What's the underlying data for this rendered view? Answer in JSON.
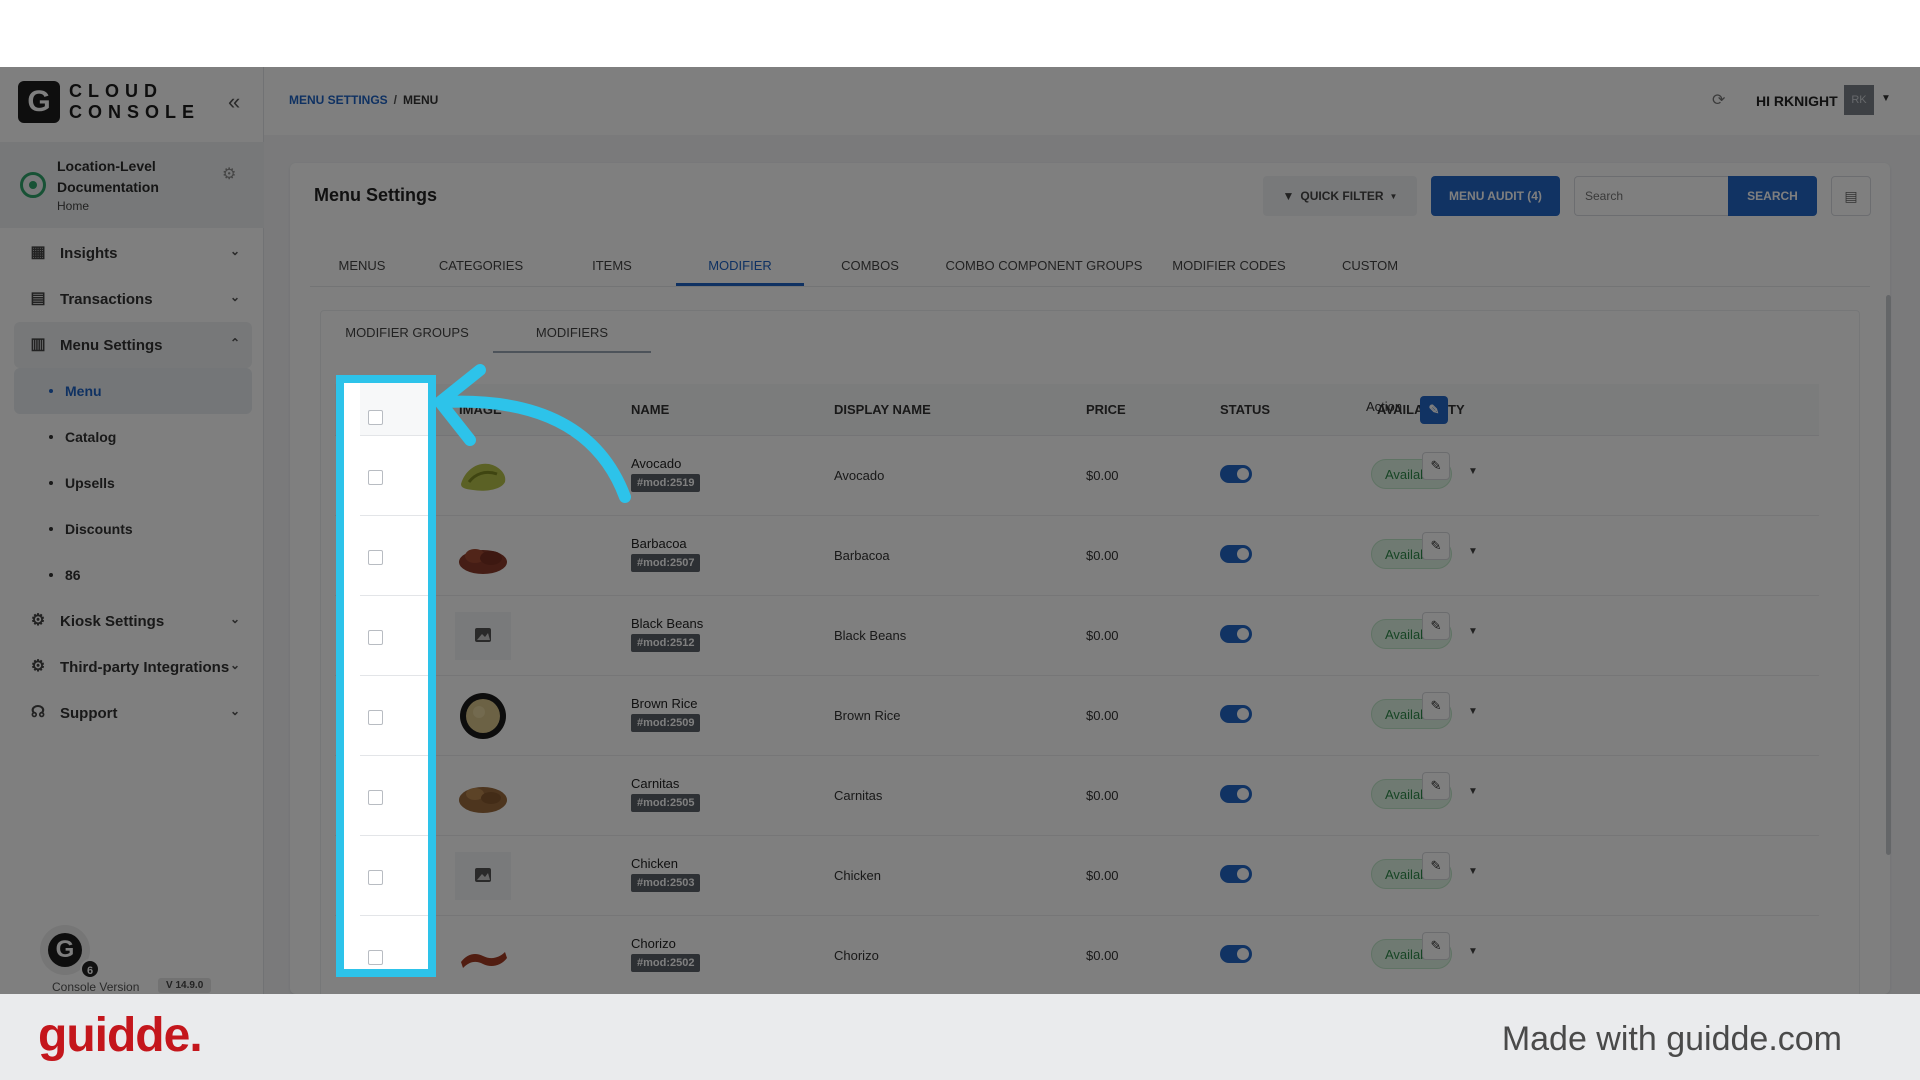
{
  "sidebar": {
    "logo_mark": "G",
    "logo_line1": "CLOUD",
    "logo_line2": "CONSOLE",
    "location_title": "Location-Level Documentation",
    "location_sub": "Home",
    "nav": [
      {
        "label": "Insights",
        "icon": "insights-icon"
      },
      {
        "label": "Transactions",
        "icon": "transactions-icon"
      },
      {
        "label": "Menu Settings",
        "icon": "menu-settings-icon"
      }
    ],
    "sub_items": [
      "Menu",
      "Catalog",
      "Upsells",
      "Discounts",
      "86"
    ],
    "nav_bottom": [
      {
        "label": "Kiosk Settings",
        "icon": "gear-icon"
      },
      {
        "label": "Third-party Integrations",
        "icon": "gear-icon"
      },
      {
        "label": "Support",
        "icon": "headset-icon"
      }
    ],
    "avatar_letter": "G",
    "avatar_badge": "6",
    "version_label": "Console Version",
    "version_num": "V 14.9.0"
  },
  "header": {
    "breadcrumb_link": "MENU SETTINGS",
    "breadcrumb_sep": "/",
    "breadcrumb_current": "MENU",
    "user_name": "HI RKNIGHT",
    "user_initials": "RK"
  },
  "card": {
    "title": "Menu Settings",
    "quick_filter": "QUICK FILTER",
    "menu_audit": "MENU AUDIT (4)",
    "search_placeholder": "Search",
    "search_button": "SEARCH",
    "tabs": [
      "MENUS",
      "CATEGORIES",
      "ITEMS",
      "MODIFIER",
      "COMBOS",
      "COMBO COMPONENT GROUPS",
      "MODIFIER CODES",
      "CUSTOM"
    ],
    "active_tab": "MODIFIER",
    "subtabs": [
      "MODIFIER GROUPS",
      "MODIFIERS"
    ],
    "active_subtab": "MODIFIERS"
  },
  "table": {
    "headers": {
      "image": "IMAGE",
      "name": "NAME",
      "display_name": "DISPLAY NAME",
      "price": "PRICE",
      "status": "STATUS",
      "availability": "AVAILABILITY",
      "action": "Action"
    },
    "rows": [
      {
        "name": "Avocado",
        "code": "#mod:2519",
        "display": "Avocado",
        "price": "$0.00",
        "availability": "Available",
        "thumb": "avocado"
      },
      {
        "name": "Barbacoa",
        "code": "#mod:2507",
        "display": "Barbacoa",
        "price": "$0.00",
        "availability": "Available",
        "thumb": "barbacoa"
      },
      {
        "name": "Black Beans",
        "code": "#mod:2512",
        "display": "Black Beans",
        "price": "$0.00",
        "availability": "Available",
        "thumb": "placeholder"
      },
      {
        "name": "Brown Rice",
        "code": "#mod:2509",
        "display": "Brown Rice",
        "price": "$0.00",
        "availability": "Available",
        "thumb": "rice"
      },
      {
        "name": "Carnitas",
        "code": "#mod:2505",
        "display": "Carnitas",
        "price": "$0.00",
        "availability": "Available",
        "thumb": "carnitas"
      },
      {
        "name": "Chicken",
        "code": "#mod:2503",
        "display": "Chicken",
        "price": "$0.00",
        "availability": "Available",
        "thumb": "placeholder"
      },
      {
        "name": "Chorizo",
        "code": "#mod:2502",
        "display": "Chorizo",
        "price": "$0.00",
        "availability": "Available",
        "thumb": "chorizo"
      }
    ]
  },
  "footer": {
    "brand": "guidde.",
    "made_with": "Made with guidde.com"
  },
  "colors": {
    "accent": "#2366c7",
    "highlight": "#2dc3ea",
    "available_bg": "#dff4e4",
    "brand_red": "#c4161c"
  }
}
